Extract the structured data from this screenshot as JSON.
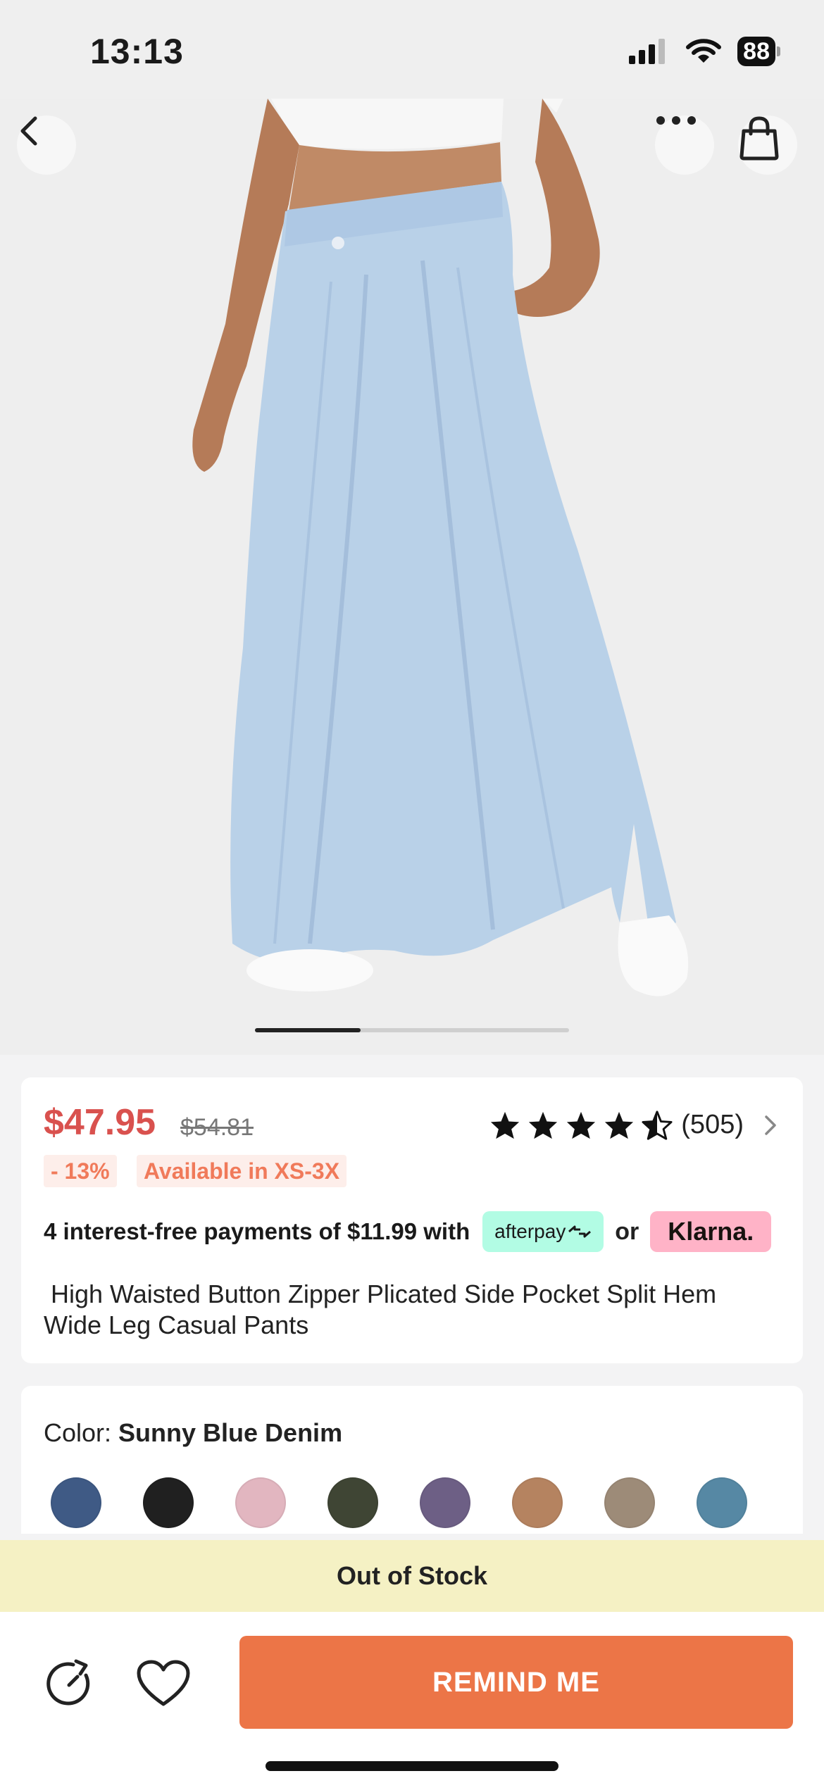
{
  "status_bar": {
    "time": "13:13",
    "battery": "88"
  },
  "header": {
    "back_icon": "chevron-left-icon",
    "more_icon": "more-dots-icon",
    "bag_icon": "shopping-bag-icon"
  },
  "gallery": {
    "image_alt": "product-photo",
    "current_index": 1,
    "total": 3
  },
  "product": {
    "price": "$47.95",
    "original_price": "$54.81",
    "rating": 4.5,
    "review_count": "(505)",
    "discount_badge": "- 13%",
    "size_badge": "Available in XS-3X",
    "payment_text": "4 interest-free payments of $11.99 with",
    "afterpay_label": "afterpay",
    "or_label": "or",
    "klarna_label": "Klarna.",
    "title": " High Waisted Button Zipper Plicated Side Pocket Split Hem Wide Leg Casual Pants"
  },
  "color": {
    "label": "Color: ",
    "selected": "Sunny Blue Denim",
    "swatches": [
      {
        "name": "navy-denim",
        "color": "#3f5a85"
      },
      {
        "name": "black",
        "color": "#202020"
      },
      {
        "name": "pink",
        "color": "#e2b6c0"
      },
      {
        "name": "olive",
        "color": "#3f4534"
      },
      {
        "name": "purple",
        "color": "#6d5f85"
      },
      {
        "name": "tan",
        "color": "#b58360"
      },
      {
        "name": "khaki",
        "color": "#9d8b78"
      },
      {
        "name": "steel-blue",
        "color": "#5688a4"
      }
    ]
  },
  "stock_notice": "Out of Stock",
  "actions": {
    "history_icon": "history-icon",
    "favorite_icon": "heart-icon",
    "remind_label": "REMIND ME"
  },
  "colors": {
    "price": "#d9514e",
    "cta": "#ec7547",
    "afterpay_bg": "#b2fce4",
    "klarna_bg": "#ffb3c7",
    "oos_bg": "#f5f1c4"
  }
}
